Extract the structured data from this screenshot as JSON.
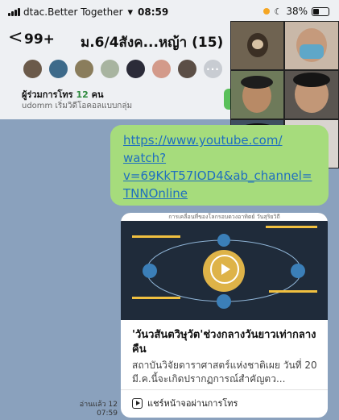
{
  "status": {
    "carrier": "dtac.Better Together",
    "time": "08:59",
    "battery": "38%",
    "battery_level": 0.38
  },
  "header": {
    "back_label": "<",
    "unread": "99+",
    "title": "ม.6/4สังค...หญ้า (15)",
    "participants_label": "ผู้ร่วมการโทร",
    "participants_count": "12",
    "participants_unit": "คน",
    "subtitle": "udomm เริ่มวิดีโอคอลแบบกลุ่ม",
    "more_avatars": "···"
  },
  "message": {
    "link_text": "https://www.youtube.com/\nwatch?\nv=69KkT57IOD4&ab_channel=\nTNNOnline",
    "preview_header": "การเคลื่อนที่ของโลกรอบดวงอาทิตย์ วันสุริยวิถี",
    "headline": "'วันวสันตวิษุวัต'ช่วงกลางวันยาวเท่ากลางคืน",
    "description": "สถาบันวิจัยดาราศาสตร์แห่งชาติเผย วันที่ 20 มี.ค.นี้จะเกิดปรากฏการณ์สำคัญตว...",
    "share_label": "แชร์หน้าจอผ่านการโทร",
    "read_label": "อ่านแล้ว 12",
    "time": "07:59"
  },
  "colors": {
    "chat_bg": "#8aa1bd",
    "bubble_green": "#a6dc7c",
    "link_blue": "#1f6fbf",
    "accent_green": "#2e8b3e"
  }
}
